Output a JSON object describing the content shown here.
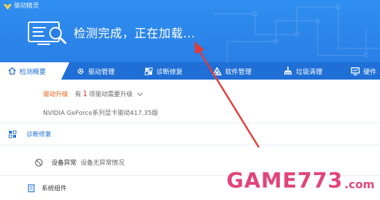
{
  "app": {
    "title": "驱动精灵"
  },
  "header": {
    "status": "检测完成，正在加载..."
  },
  "tabs": [
    {
      "label": "检测概要",
      "icon": "home-icon",
      "active": true
    },
    {
      "label": "驱动管理",
      "icon": "gear-icon"
    },
    {
      "label": "诊断修复",
      "icon": "puzzle-icon"
    },
    {
      "label": "软件管理",
      "icon": "triangle-icon"
    },
    {
      "label": "垃圾清理",
      "icon": "broom-icon"
    },
    {
      "label": "硬件",
      "icon": "monitor-icon"
    }
  ],
  "driver_upgrade": {
    "label": "驱动升级",
    "prefix": "有",
    "count": "1",
    "suffix": "项驱动需要升级",
    "item": "NVIDIA GeForce系列显卡驱动417.35版"
  },
  "diagnose": {
    "label": "诊断修复"
  },
  "device": {
    "label": "设备异常",
    "desc": "设备无异常情况"
  },
  "component": {
    "label": "系统组件"
  },
  "watermark": {
    "main": "GAME773",
    "suffix": ".com"
  },
  "colors": {
    "header_blue": "#2a7fe6",
    "tab_blue": "#1f6fd6",
    "accent_orange": "#e8590c",
    "arrow_red": "#e53935",
    "watermark_pink": "#e0467a"
  }
}
